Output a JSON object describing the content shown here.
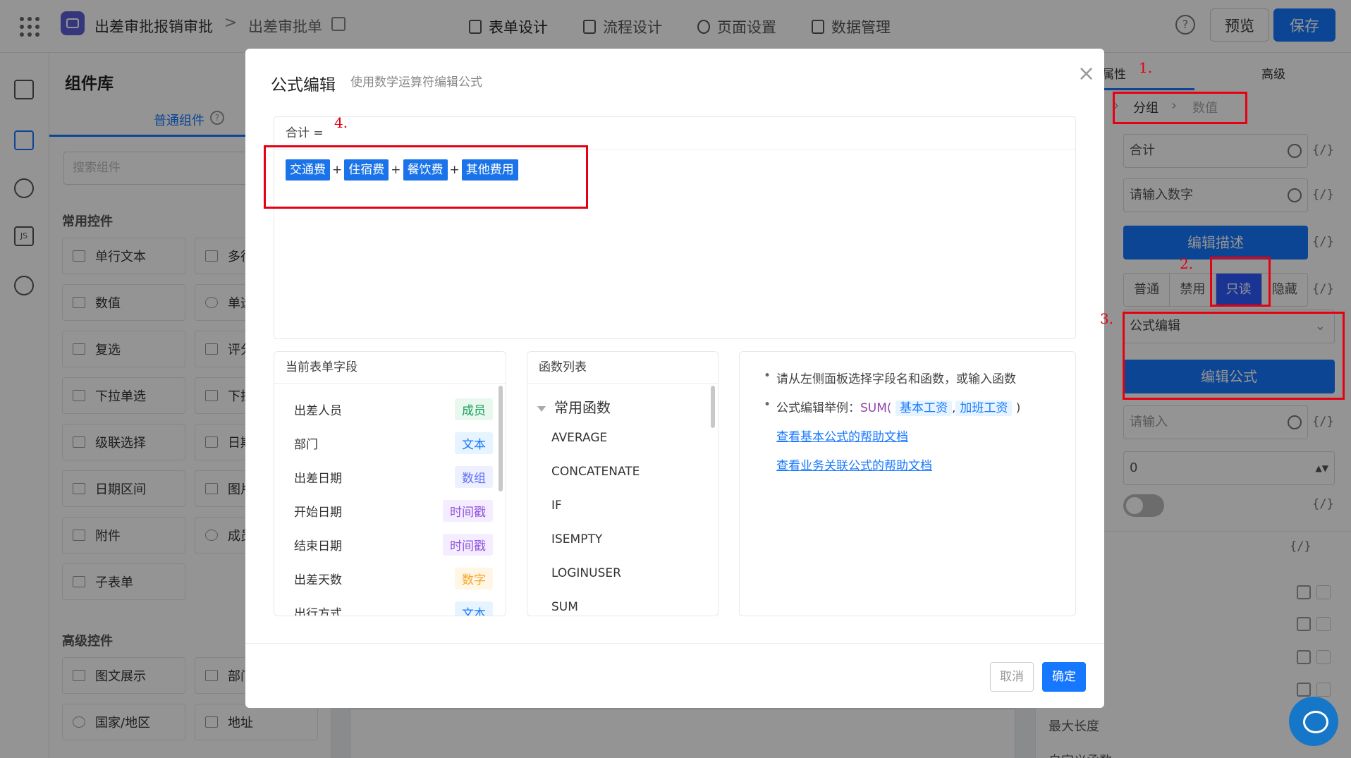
{
  "topbar": {
    "app_name": "出差审批报销审批",
    "crumb_sep": ">",
    "form_name": "出差审批单",
    "tabs": [
      {
        "label": "表单设计"
      },
      {
        "label": "流程设计"
      },
      {
        "label": "页面设置"
      },
      {
        "label": "数据管理"
      }
    ],
    "help": "?",
    "preview": "预览",
    "save": "保存"
  },
  "rail": {
    "js_label": "JS"
  },
  "components": {
    "title": "组件库",
    "tab": "普通组件",
    "tab_help": "?",
    "search_placeholder": "搜索组件",
    "common_title": "常用控件",
    "common": [
      "单行文本",
      "多行",
      "数值",
      "单选",
      "复选",
      "评分",
      "下拉单选",
      "下拉",
      "级联选择",
      "日期",
      "日期区间",
      "图片",
      "附件",
      "成员",
      "子表单"
    ],
    "advanced_title": "高级控件",
    "advanced": [
      "图文展示",
      "部门",
      "国家/地区",
      "地址"
    ]
  },
  "props": {
    "tab_attr": "属性",
    "tab_advanced": "高级",
    "crumb_group": "分组",
    "crumb_value": "数值",
    "title_value": "合计",
    "placeholder_value": "请输入数字",
    "edit_desc": "编辑描述",
    "status": [
      "普通",
      "禁用",
      "只读",
      "隐藏"
    ],
    "status_selected": "只读",
    "default_mode": "公式编辑",
    "edit_formula": "编辑公式",
    "input_placeholder": "请输入",
    "number_value": "0",
    "fx": "{/}",
    "max_length": "最大长度",
    "custom_fn": "自定义函数"
  },
  "modal": {
    "title": "公式编辑",
    "subtitle": "使用数学运算符编辑公式",
    "close": "×",
    "editor_head": "合计 =",
    "formula": [
      {
        "type": "field",
        "text": "交通费"
      },
      {
        "type": "op",
        "text": "+"
      },
      {
        "type": "field",
        "text": "住宿费"
      },
      {
        "type": "op",
        "text": "+"
      },
      {
        "type": "field",
        "text": "餐饮费"
      },
      {
        "type": "op",
        "text": "+"
      },
      {
        "type": "field",
        "text": "其他费用"
      }
    ],
    "fields_title": "当前表单字段",
    "fields": [
      {
        "name": "出差人员",
        "tag": "成员",
        "color": "green"
      },
      {
        "name": "部门",
        "tag": "文本",
        "color": "blue"
      },
      {
        "name": "出差日期",
        "tag": "数组",
        "color": "indigo"
      },
      {
        "name": "开始日期",
        "tag": "时间戳",
        "color": "purple"
      },
      {
        "name": "结束日期",
        "tag": "时间戳",
        "color": "purple"
      },
      {
        "name": "出差天数",
        "tag": "数字",
        "color": "orange"
      },
      {
        "name": "出行方式",
        "tag": "文本",
        "color": "blue"
      }
    ],
    "functions_title": "函数列表",
    "function_group": "常用函数",
    "functions": [
      "AVERAGE",
      "CONCATENATE",
      "IF",
      "ISEMPTY",
      "LOGINUSER",
      "SUM"
    ],
    "help_1": "请从左侧面板选择字段名和函数，或输入函数",
    "help_2_prefix": "公式编辑举例：",
    "help_2_fn": "SUM(",
    "help_2_arg1": "基本工资",
    "help_2_comma": ",",
    "help_2_arg2": "加班工资",
    "help_2_close": ")",
    "link_1": "查看基本公式的帮助文档",
    "link_2": "查看业务关联公式的帮助文档",
    "cancel": "取消",
    "ok": "确定"
  },
  "annotations": [
    "1.",
    "2.",
    "3.",
    "4."
  ],
  "colors": {
    "accent": "#1677ff",
    "annotation": "#e60012"
  }
}
